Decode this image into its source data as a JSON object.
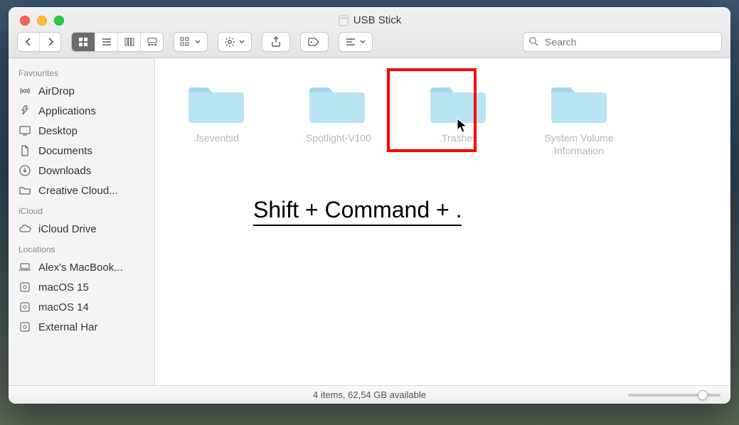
{
  "window": {
    "title": "USB Stick"
  },
  "toolbar": {
    "search_placeholder": "Search"
  },
  "sidebar": {
    "sections": [
      {
        "label": "Favourites",
        "items": [
          {
            "label": "AirDrop",
            "icon": "airdrop"
          },
          {
            "label": "Applications",
            "icon": "applications"
          },
          {
            "label": "Desktop",
            "icon": "desktop"
          },
          {
            "label": "Documents",
            "icon": "documents"
          },
          {
            "label": "Downloads",
            "icon": "downloads"
          },
          {
            "label": "Creative Cloud...",
            "icon": "folder"
          }
        ]
      },
      {
        "label": "iCloud",
        "items": [
          {
            "label": "iCloud Drive",
            "icon": "cloud"
          }
        ]
      },
      {
        "label": "Locations",
        "items": [
          {
            "label": "Alex's MacBook...",
            "icon": "laptop"
          },
          {
            "label": "macOS 15",
            "icon": "disk"
          },
          {
            "label": "macOS 14",
            "icon": "disk"
          },
          {
            "label": "External Har",
            "icon": "disk-ext"
          }
        ]
      }
    ]
  },
  "folders": [
    {
      "label": ".fseventsd"
    },
    {
      "label": ".Spotlight-V100"
    },
    {
      "label": ".Trashes"
    },
    {
      "label": "System Volume Information"
    }
  ],
  "highlight_index": 2,
  "overlay": {
    "text": "Shift + Command + ."
  },
  "statusbar": {
    "text": "4 items, 62,54 GB available"
  }
}
